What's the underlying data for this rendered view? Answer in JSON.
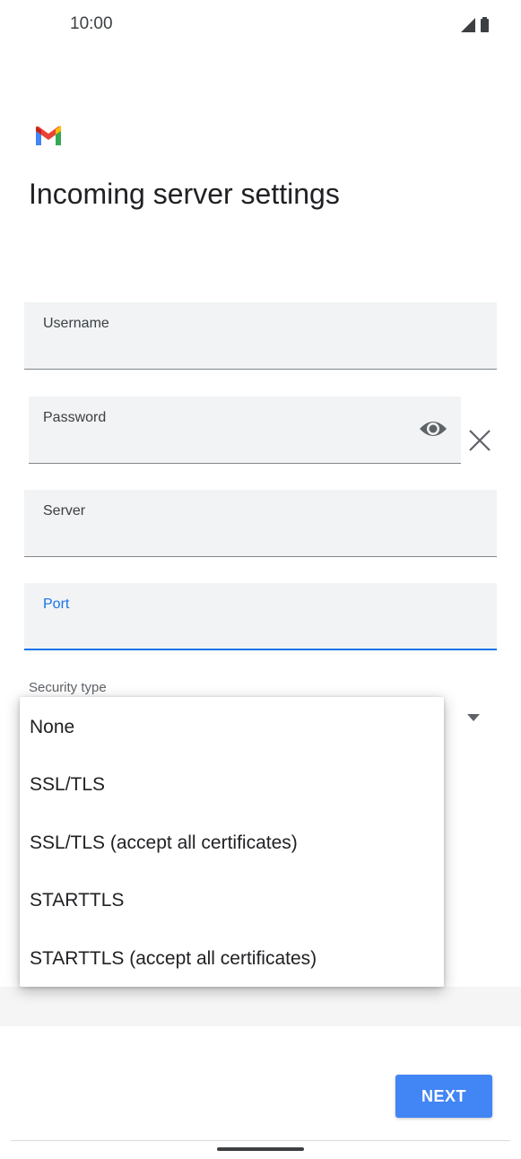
{
  "status_bar": {
    "time": "10:00",
    "icons": [
      "signal-icon",
      "battery-icon"
    ]
  },
  "header": {
    "logo": "gmail-logo",
    "title": "Incoming server settings"
  },
  "form": {
    "username": {
      "label": "Username",
      "value": ""
    },
    "password": {
      "label": "Password",
      "value": "",
      "icons": [
        "visibility-eye-icon",
        "clear-x-icon"
      ]
    },
    "server": {
      "label": "Server",
      "value": ""
    },
    "port": {
      "label": "Port",
      "value": "",
      "focused": true
    },
    "security_type": {
      "label": "Security type",
      "options": [
        "None",
        "SSL/TLS",
        "SSL/TLS (accept all certificates)",
        "STARTTLS",
        "STARTTLS (accept all certificates)"
      ]
    }
  },
  "footer": {
    "next_label": "NEXT"
  },
  "colors": {
    "accent": "#1a73e8",
    "button": "#4285f4",
    "field_bg": "#f1f3f4"
  }
}
